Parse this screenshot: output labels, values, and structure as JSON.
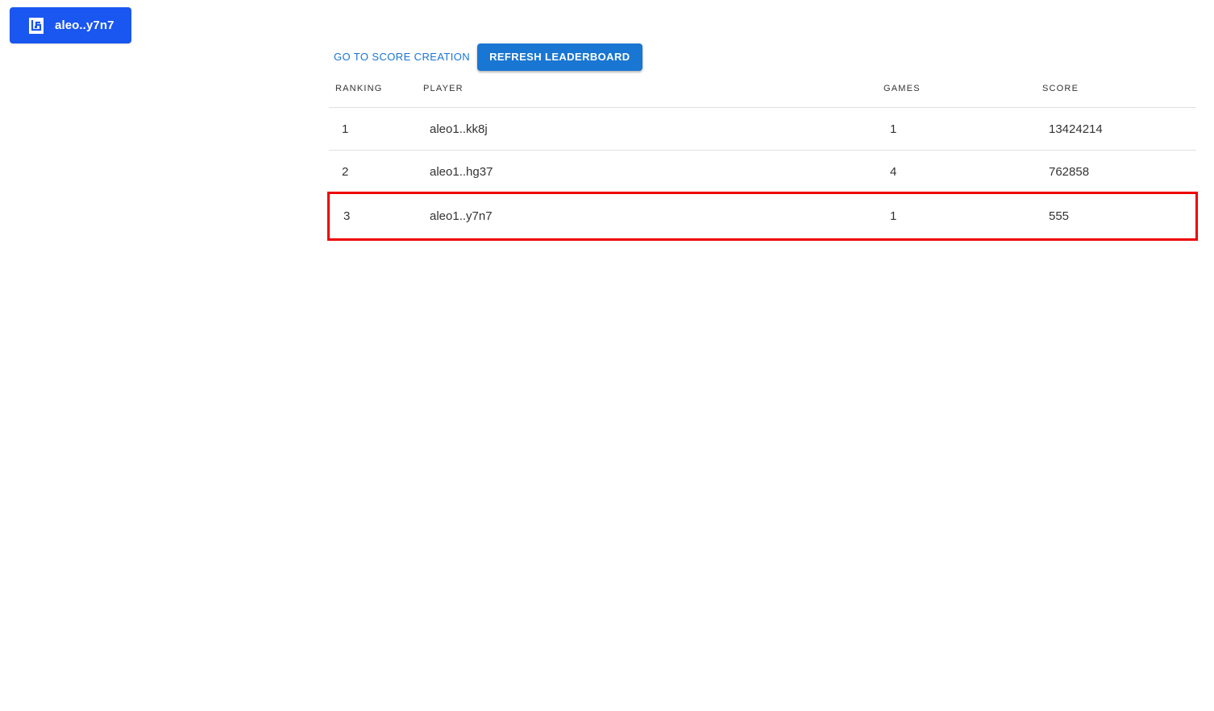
{
  "wallet": {
    "icon": "leo-wallet-icon",
    "label": "aleo..y7n7",
    "color": "#1a56f0"
  },
  "toolbar": {
    "score_creation_label": "GO TO SCORE CREATION",
    "refresh_label": "REFRESH LEADERBOARD",
    "accent": "#1976d2"
  },
  "leaderboard": {
    "columns": [
      "RANKING",
      "PLAYER",
      "GAMES",
      "SCORE"
    ],
    "rows": [
      {
        "ranking": "1",
        "player": "aleo1..kk8j",
        "games": "1",
        "score": "13424214"
      },
      {
        "ranking": "2",
        "player": "aleo1..hg37",
        "games": "4",
        "score": "762858"
      },
      {
        "ranking": "3",
        "player": "aleo1..y7n7",
        "games": "1",
        "score": "555"
      }
    ],
    "highlight_color": "#ee0000"
  }
}
